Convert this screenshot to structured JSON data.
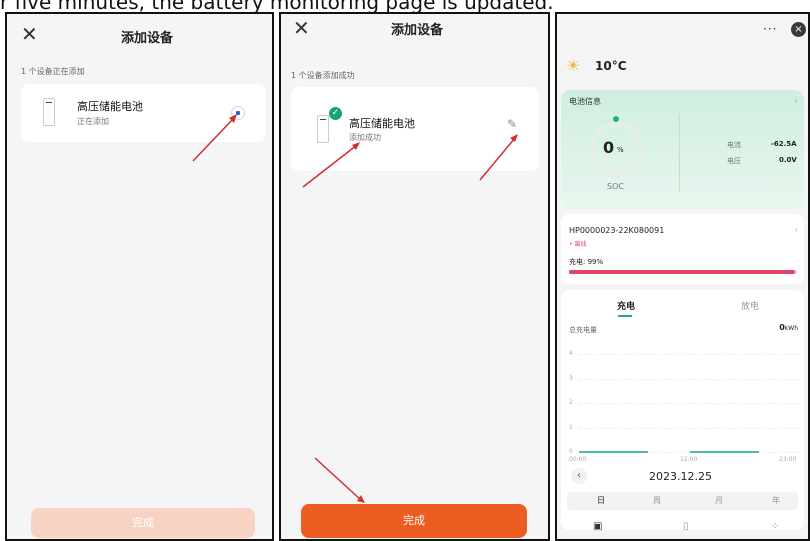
{
  "caption": "r five minutes,  the battery monitoring page is updated.",
  "screen1": {
    "close_icon": "close-icon",
    "title": "添加设备",
    "status_text": "1 个设备正在添加",
    "device_name": "高压储能电池",
    "device_sub": "正在添加",
    "done_label": "完成",
    "done_color": "#f8d3c3"
  },
  "screen2": {
    "close_icon": "close-icon",
    "title": "添加设备",
    "status_text": "1 个设备添加成功",
    "device_name": "高压储能电池",
    "device_sub": "添加成功",
    "done_label": "完成",
    "done_color": "#ec5d22"
  },
  "screen3": {
    "menu_label": "···",
    "close_label": "×",
    "temperature": "10°C",
    "battery_info": {
      "title": "电池信息",
      "soc_value": "0",
      "soc_unit": "%",
      "soc_label": "SOC",
      "current_label": "电流",
      "current_value": "-62.5A",
      "voltage_label": "电压",
      "voltage_value": "0.0V"
    },
    "device": {
      "id": "HP0000023-22K080091",
      "status": "• 离线",
      "charge_label": "充电: 99%",
      "charge_fraction": 0.99
    },
    "energy": {
      "tab_charge": "充电",
      "tab_discharge": "放电",
      "total_label": "总充电量",
      "total_value": "0",
      "total_unit": "kWh",
      "date": "2023.12.25",
      "periods": [
        "日",
        "周",
        "月",
        "年"
      ]
    }
  },
  "chart_data": {
    "type": "line",
    "x": [
      "00:00",
      "12:00",
      "23:00"
    ],
    "yticks": [
      "4",
      "3",
      "2",
      "1",
      "0"
    ],
    "ylim": [
      0,
      4
    ],
    "series": [
      {
        "values": [
          0,
          0,
          0
        ]
      }
    ],
    "xlabel": "",
    "ylabel": ""
  },
  "colors": {
    "accent_orange": "#ec5d22",
    "green": "#1fb46e",
    "red": "#df4766",
    "arrow": "#d32f2f"
  }
}
